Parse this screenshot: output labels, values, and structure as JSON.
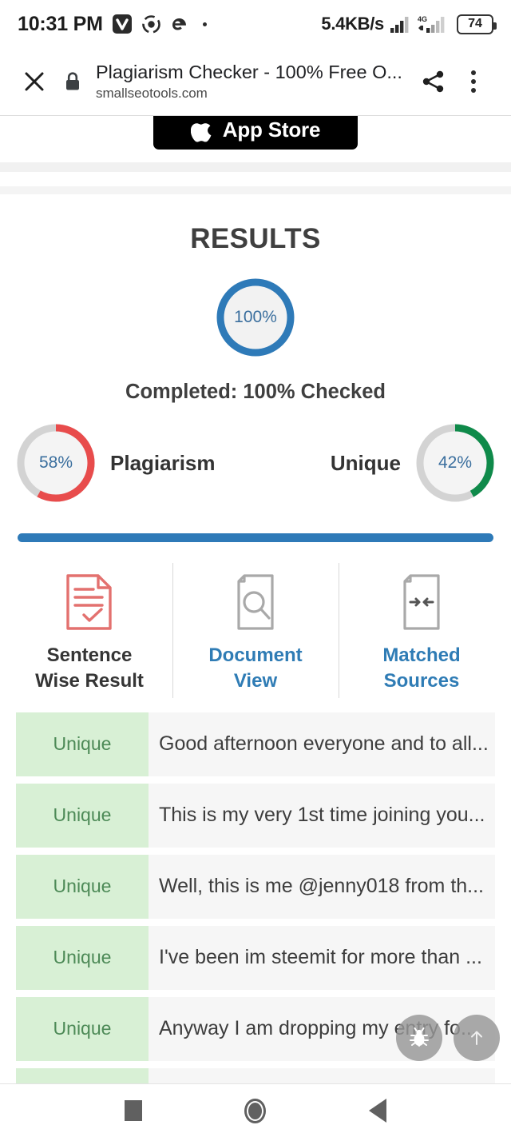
{
  "status_bar": {
    "time": "10:31 PM",
    "icons": [
      "vivaldi-icon",
      "share-network-icon",
      "edge-icon",
      "dot-icon"
    ],
    "network_speed": "5.4KB/s",
    "network_type": "4G",
    "battery_level": "74"
  },
  "browser": {
    "close_label": "close-icon",
    "secure_icon": "lock-icon",
    "page_title": "Plagiarism Checker - 100% Free O...",
    "host": "smallseotools.com",
    "share_label": "share-icon",
    "menu_label": "more-options-icon"
  },
  "banner": {
    "app_store_label": "App Store"
  },
  "results": {
    "heading": "RESULTS",
    "completion_percent": "100%",
    "completed_text": "Completed: 100% Checked",
    "plagiarism": {
      "percent": "58%",
      "label": "Plagiarism",
      "value": 58,
      "color": "#e84c4c"
    },
    "unique": {
      "percent": "42%",
      "label": "Unique",
      "value": 42,
      "color": "#0f8a4a"
    },
    "ring_track_color": "#d3d3d3",
    "ring_accent_color": "#2e7ab8",
    "ring_text_color": "#3b6f9e"
  },
  "tabs": [
    {
      "label_line1": "Sentence",
      "label_line2": "Wise Result",
      "icon": "document-check-icon",
      "active": true
    },
    {
      "label_line1": "Document",
      "label_line2": "View",
      "icon": "document-search-icon",
      "active": false
    },
    {
      "label_line1": "Matched",
      "label_line2": "Sources",
      "icon": "document-arrows-icon",
      "active": false
    }
  ],
  "sentence_rows": [
    {
      "badge": "Unique",
      "text": "Good afternoon everyone and to all..."
    },
    {
      "badge": "Unique",
      "text": "This is my very 1st time joining you..."
    },
    {
      "badge": "Unique",
      "text": "Well, this is me @jenny018 from th..."
    },
    {
      "badge": "Unique",
      "text": "I've been im steemit for more than ..."
    },
    {
      "badge": "Unique",
      "text": "Anyway I am dropping my entry fo..."
    },
    {
      "badge": "",
      "text": ""
    }
  ],
  "fabs": [
    {
      "name": "bug-report-fab",
      "icon": "bug-icon"
    },
    {
      "name": "scroll-to-top-fab",
      "icon": "arrow-up-icon"
    }
  ],
  "nav_bar": {
    "recents": "recents-square-icon",
    "home": "home-circle-icon",
    "back": "back-triangle-icon"
  }
}
